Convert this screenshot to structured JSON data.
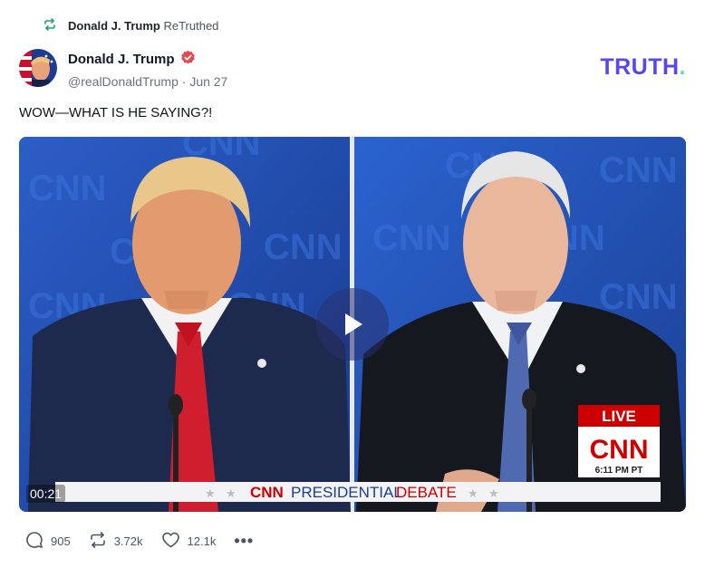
{
  "retruth": {
    "name": "Donald J. Trump",
    "label": "ReTruthed"
  },
  "author": {
    "name": "Donald J. Trump",
    "handle": "@realDonaldTrump",
    "date": "Jun 27",
    "separator": "·"
  },
  "brand": {
    "logo_main": "TRUTH",
    "logo_dot": ".",
    "primary_color": "#5448ee",
    "dot_color": "#5ed6c9"
  },
  "post": {
    "text": "WOW—WHAT IS HE SAYING?!"
  },
  "video": {
    "duration": "00:21",
    "watermark": "CNN",
    "chyron_brand": "CNN",
    "chyron_left": "PRESIDENTIAL",
    "chyron_right": "DEBATE",
    "live_label": "LIVE",
    "live_brand": "CNN",
    "live_time": "6:11 PM PT"
  },
  "stats": {
    "replies": "905",
    "retruths": "3.72k",
    "likes": "12.1k"
  },
  "icons": [
    "retruth-icon",
    "verified-badge-icon",
    "play-icon",
    "reply-icon",
    "like-icon",
    "more-icon"
  ]
}
